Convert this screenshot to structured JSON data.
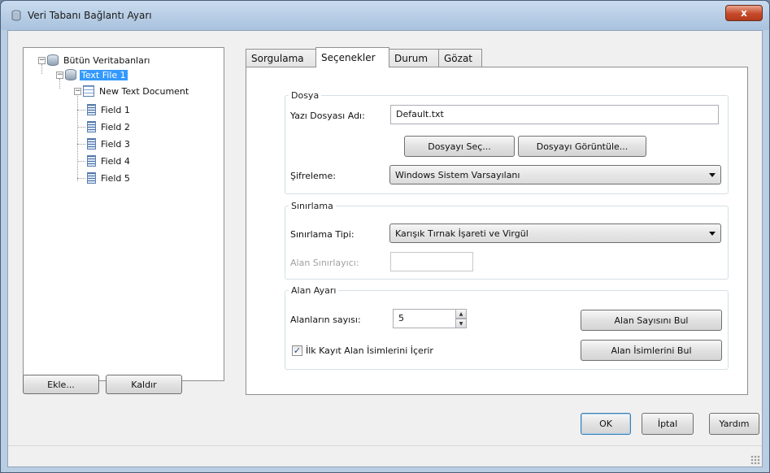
{
  "window": {
    "title": "Veri Tabanı Bağlantı Ayarı",
    "close_label": "x"
  },
  "tree": {
    "root": "Bütün Veritabanları",
    "file": "Text File 1",
    "table": "New Text Document",
    "fields": [
      "Field 1",
      "Field 2",
      "Field 3",
      "Field 4",
      "Field 5"
    ]
  },
  "left_buttons": {
    "add": "Ekle...",
    "remove": "Kaldır"
  },
  "tabs": [
    "Sorgulama",
    "Seçenekler",
    "Durum",
    "Gözat"
  ],
  "active_tab": "Seçenekler",
  "dosya": {
    "legend": "Dosya",
    "filename_label": "Yazı Dosyası Adı:",
    "filename_value": "Default.txt",
    "choose_button": "Dosyayı Seç...",
    "view_button": "Dosyayı Görüntüle...",
    "encoding_label": "Şifreleme:",
    "encoding_value": "Windows Sistem Varsayılanı"
  },
  "sinirlama": {
    "legend": "Sınırlama",
    "type_label": "Sınırlama Tipi:",
    "type_value": "Karışık Tırnak İşareti ve Virgül",
    "field_delim_label": "Alan Sınırlayıcı:",
    "field_delim_value": ""
  },
  "alan": {
    "legend": "Alan Ayarı",
    "count_label": "Alanların sayısı:",
    "count_value": "5",
    "find_count_button": "Alan Sayısını Bul",
    "first_row_label": "İlk Kayıt Alan İsimlerini İçerir",
    "first_row_checked": true,
    "find_names_button": "Alan İsimlerini Bul"
  },
  "dialog_buttons": {
    "ok": "OK",
    "cancel": "İptal",
    "help": "Yardım"
  }
}
